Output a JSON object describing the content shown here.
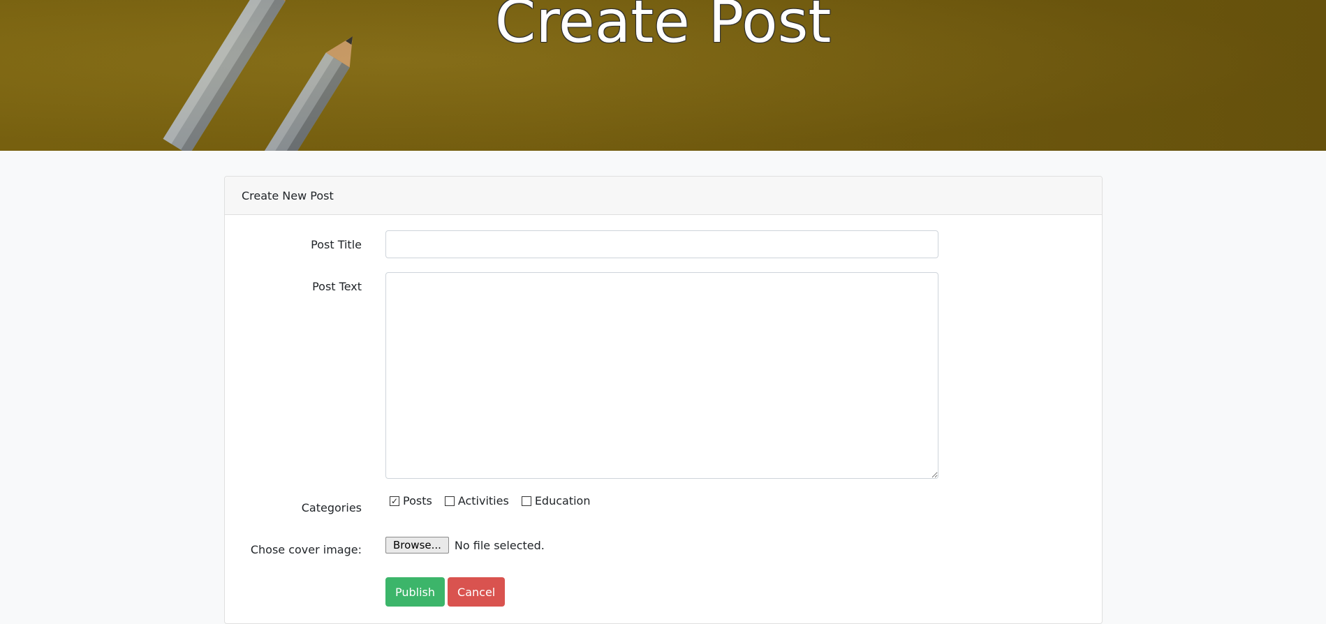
{
  "hero": {
    "title": "Create Post"
  },
  "card": {
    "header": "Create New Post"
  },
  "form": {
    "post_title_label": "Post Title",
    "post_title_value": "",
    "post_text_label": "Post Text",
    "post_text_value": "",
    "categories_label": "Categories",
    "categories": [
      {
        "label": "Posts",
        "checked": true
      },
      {
        "label": "Activities",
        "checked": false
      },
      {
        "label": "Education",
        "checked": false
      }
    ],
    "cover_label": "Chose cover image:",
    "browse_label": "Browse...",
    "file_status": "No file selected.",
    "publish_label": "Publish",
    "cancel_label": "Cancel"
  },
  "icons": {
    "checkmark": "checkmark-icon",
    "resize": "resize-handle-icon",
    "pencils": "pencils-photo"
  },
  "colors": {
    "publish": "#3cb56a",
    "cancel": "#d9534f",
    "hero": "#7a6210"
  }
}
